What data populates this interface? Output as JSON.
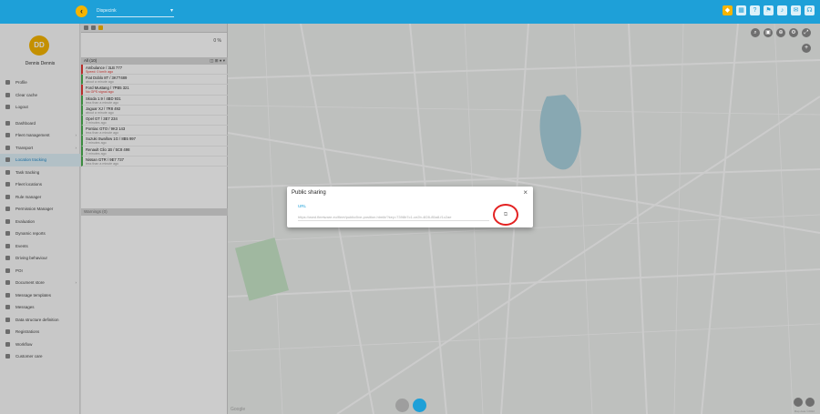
{
  "topbar": {
    "select_value": "Dispecink",
    "icons": [
      "tag-icon",
      "grid-icon",
      "help-icon",
      "flag-icon",
      "bell-icon",
      "message-icon",
      "headset-icon"
    ]
  },
  "sidebar": {
    "avatar_initials": "DD",
    "user_name": "Dennis Dennis",
    "items": [
      {
        "label": "Profile"
      },
      {
        "label": "Clear cache"
      },
      {
        "label": "Logout"
      },
      {
        "label": "Dashboard"
      },
      {
        "label": "Fleet management"
      },
      {
        "label": "Transport"
      },
      {
        "label": "Location tracking"
      },
      {
        "label": "Task tracking"
      },
      {
        "label": "Fleet locations"
      },
      {
        "label": "Rule manager"
      },
      {
        "label": "Permission Manager"
      },
      {
        "label": "Evaluation"
      },
      {
        "label": "Dynamic reports"
      },
      {
        "label": "Events"
      },
      {
        "label": "Driving behaviour"
      },
      {
        "label": "POI"
      },
      {
        "label": "Document store"
      },
      {
        "label": "Message templates"
      },
      {
        "label": "Messages"
      },
      {
        "label": "Data structure definition"
      },
      {
        "label": "Registrations"
      },
      {
        "label": "Workflow"
      },
      {
        "label": "Customer care"
      }
    ]
  },
  "vehicles": {
    "percent": "0 %",
    "list_title": "All (10)",
    "rows": [
      {
        "name": "Ambulance / 3LB 777",
        "status": "Speed: 0 km/h ago",
        "alert": true
      },
      {
        "name": "Fiat Doblo 8T / 3K77489",
        "status": "about a minute ago",
        "alert": false
      },
      {
        "name": "Ford Mustang / 7PB5 321",
        "status": "No GPS signal ago",
        "alert": true
      },
      {
        "name": "Skoda 1.9 / 4BD 931",
        "status": "less than a minute ago",
        "alert": false
      },
      {
        "name": "Jaguar XJ / 7R8 492",
        "status": "about a minute ago",
        "alert": false
      },
      {
        "name": "Opel GT / 3E7 234",
        "status": "3 minutes ago",
        "alert": false
      },
      {
        "name": "Pontiac GTO / 9K3 143",
        "status": "less than a minute ago",
        "alert": false
      },
      {
        "name": "Suzuki Swallow 1G / 8B5 997",
        "status": "2 minutes ago",
        "alert": false
      },
      {
        "name": "Renault Clio 1B / 5C8 498",
        "status": "3 minutes ago",
        "alert": false
      },
      {
        "name": "Nissan GTR / 9E7 737",
        "status": "less than a minute ago",
        "alert": false
      }
    ],
    "second_section": "Warnings (0)"
  },
  "dialog": {
    "title": "Public sharing",
    "close": "×",
    "url_label": "URL",
    "url_value": "https://wwd.fleetware.eu/fleet/public/live-position.html#/?key=7398b7c1-ce2b-4f28-85a8-f1c2ae",
    "copy_icon": "copy-icon"
  },
  "map": {
    "google": "Google",
    "mapdata": "Map data ©2022"
  }
}
